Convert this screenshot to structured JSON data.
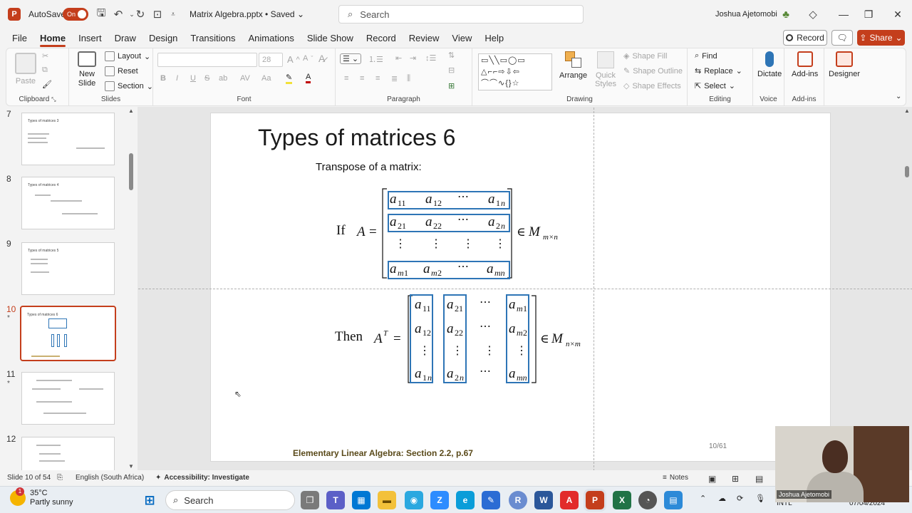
{
  "titlebar": {
    "autosave_label": "AutoSave",
    "autosave_state": "On",
    "document_title": "Matrix Algebra.pptx • Saved",
    "search_placeholder": "Search",
    "user_name": "Joshua Ajetomobi"
  },
  "menu": {
    "items": [
      "File",
      "Home",
      "Insert",
      "Draw",
      "Design",
      "Transitions",
      "Animations",
      "Slide Show",
      "Record",
      "Review",
      "View",
      "Help"
    ],
    "active": "Home",
    "record_label": "Record",
    "share_label": "Share"
  },
  "ribbon": {
    "clipboard": {
      "paste": "Paste",
      "label": "Clipboard"
    },
    "slides": {
      "new_slide": "New Slide",
      "layout": "Layout",
      "reset": "Reset",
      "section": "Section",
      "label": "Slides"
    },
    "font": {
      "size_value": "28",
      "label": "Font"
    },
    "paragraph": {
      "label": "Paragraph"
    },
    "drawing": {
      "arrange": "Arrange",
      "quick_styles": "Quick Styles",
      "shape_fill": "Shape Fill",
      "shape_outline": "Shape Outline",
      "shape_effects": "Shape Effects",
      "label": "Drawing"
    },
    "editing": {
      "find": "Find",
      "replace": "Replace",
      "select": "Select",
      "label": "Editing"
    },
    "voice": {
      "dictate": "Dictate",
      "label": "Voice"
    },
    "addins": {
      "addins": "Add-ins",
      "label": "Add-ins"
    },
    "designer": {
      "designer": "Designer"
    }
  },
  "thumbnails": [
    {
      "num": "7",
      "title": "Types of matrices 3",
      "star": ""
    },
    {
      "num": "8",
      "title": "Types of matrices 4",
      "star": ""
    },
    {
      "num": "9",
      "title": "Types of matrices 5",
      "star": ""
    },
    {
      "num": "10",
      "title": "Types of matrices 6",
      "star": "*"
    },
    {
      "num": "11",
      "title": "",
      "star": "*"
    },
    {
      "num": "12",
      "title": "",
      "star": ""
    }
  ],
  "slide": {
    "title": "Types of matrices 6",
    "subtitle": "Transpose of a matrix:",
    "if_label": "If",
    "then_label": "Then",
    "footer": "Elementary Linear Algebra: Section 2.2, p.67",
    "page": "10/61"
  },
  "statusbar": {
    "slide_info": "Slide 10 of 54",
    "language": "English (South Africa)",
    "accessibility": "Accessibility: Investigate",
    "notes": "Notes"
  },
  "taskbar": {
    "temperature": "35°C",
    "weather": "Partly sunny",
    "search": "Search",
    "keyboard": "INTL",
    "date": "07/04/2024"
  },
  "webcam": {
    "name": "Joshua Ajetomobi"
  },
  "colors": {
    "accent": "#c43e1c",
    "highlight_box": "#2e75b6"
  }
}
